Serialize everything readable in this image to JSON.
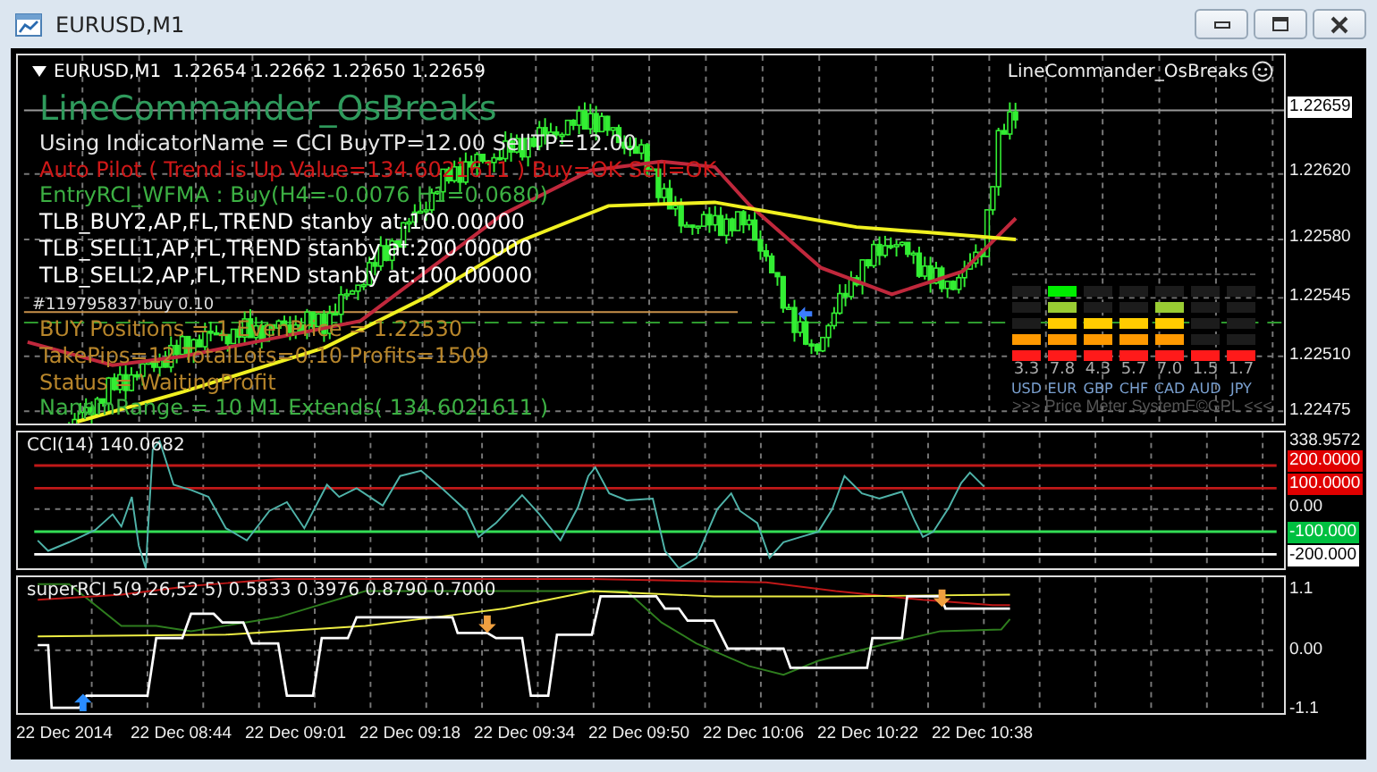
{
  "window": {
    "title": "EURUSD,M1"
  },
  "main_chart": {
    "header": "EURUSD,M1  1.22654 1.22662 1.22650 1.22659",
    "ea_title": "LineCommander_OsBreaks",
    "ea_badge": "LineCommander_OsBreaks",
    "info_lines": [
      {
        "text": "Using IndicatorName = CCI BuyTP=12.00 SellTP=12.00",
        "color": "#e6e6e6"
      },
      {
        "text": "Auto Pilot ( Trend is Up Value=134.6021611 ) Buy=OK Sell=OK",
        "color": "#d01818"
      },
      {
        "text": "EntryRCI_WFMA : Buy(H4=-0.0076 H1=0.0680)",
        "color": "#3cb043"
      },
      {
        "text": "TLB_BUY2,AP,FL,TREND stanby at:100.00000",
        "color": "#ffffff"
      },
      {
        "text": "TLB_SELL1,AP,FL,TREND stanby at:200.00000",
        "color": "#ffffff"
      },
      {
        "text": "TLB_SELL2,AP,FL,TREND stanby at:100.00000",
        "color": "#ffffff"
      }
    ],
    "order_label": "#119795837 buy 0.10",
    "status_lines": [
      {
        "text": "BUY Positions = 1 EvenPrice = 1.22530",
        "color": "#b8862b"
      },
      {
        "text": "TakePips=12 TotalLots=0.10 Profits=1509",
        "color": "#b8862b"
      },
      {
        "text": "Status = WaitingProfit",
        "color": "#b8862b"
      },
      {
        "text": "NanpinRange = 10 M1 Extends( 134.6021611 )",
        "color": "#3cb043"
      }
    ],
    "price_axis": [
      {
        "label": "1.22659",
        "kind": "box",
        "color": "#ffffff"
      },
      {
        "label": "1.22620",
        "kind": "plain"
      },
      {
        "label": "1.22580",
        "kind": "plain"
      },
      {
        "label": "1.22545",
        "kind": "plain"
      },
      {
        "label": "1.22510",
        "kind": "plain"
      },
      {
        "label": "1.22475",
        "kind": "plain"
      }
    ],
    "price_meter": {
      "currencies": [
        {
          "value": "3.3",
          "currency": "USD",
          "level": 0.4
        },
        {
          "value": "7.8",
          "currency": "EUR",
          "level": 1.0
        },
        {
          "value": "4.3",
          "currency": "GBP",
          "level": 0.6
        },
        {
          "value": "5.7",
          "currency": "CHF",
          "level": 0.6
        },
        {
          "value": "7.0",
          "currency": "CAD",
          "level": 0.8
        },
        {
          "value": "1.5",
          "currency": "AUD",
          "level": 0.2
        },
        {
          "value": "1.7",
          "currency": "JPY",
          "level": 0.2
        }
      ],
      "footer": ">>> Price Meter SystemE©GPL <<<"
    }
  },
  "cci_panel": {
    "label": "CCI(14) 140.0682",
    "axis": [
      {
        "label": "338.9572",
        "kind": "plain"
      },
      {
        "label": "200.0000",
        "kind": "box",
        "color": "#e00000"
      },
      {
        "label": "100.0000",
        "kind": "box",
        "color": "#e00000"
      },
      {
        "label": "0.00",
        "kind": "plain"
      },
      {
        "label": "-100.000",
        "kind": "box",
        "color": "#00c040"
      },
      {
        "label": "-200.000",
        "kind": "box",
        "color": "#ffffff"
      }
    ]
  },
  "rci_panel": {
    "label": "superRCI 5(9,26,52 5) 0.5833 0.3976 0.8790 0.7000",
    "axis": [
      {
        "label": "1.1"
      },
      {
        "label": "0.00"
      },
      {
        "label": "-1.1"
      }
    ]
  },
  "time_axis": [
    "22 Dec 2014",
    "22 Dec 08:44",
    "22 Dec 09:01",
    "22 Dec 09:18",
    "22 Dec 09:34",
    "22 Dec 09:50",
    "22 Dec 10:06",
    "22 Dec 10:22",
    "22 Dec 10:38"
  ]
}
